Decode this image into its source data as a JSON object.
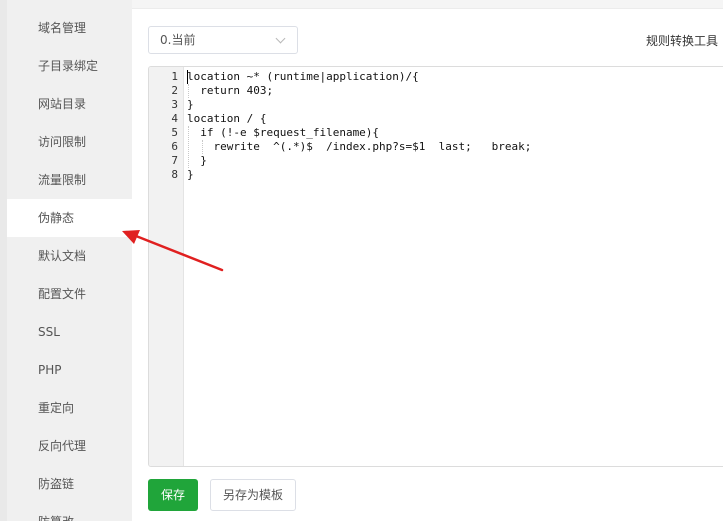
{
  "sidebar": {
    "items": [
      {
        "label": "域名管理"
      },
      {
        "label": "子目录绑定"
      },
      {
        "label": "网站目录"
      },
      {
        "label": "访问限制"
      },
      {
        "label": "流量限制"
      },
      {
        "label": "伪静态"
      },
      {
        "label": "默认文档"
      },
      {
        "label": "配置文件"
      },
      {
        "label": "SSL"
      },
      {
        "label": "PHP"
      },
      {
        "label": "重定向"
      },
      {
        "label": "反向代理"
      },
      {
        "label": "防盗链"
      },
      {
        "label": "防篡改"
      }
    ],
    "active_index": 5
  },
  "toolbar": {
    "version_select_value": "0.当前",
    "rule_tool_label": "规则转换工具"
  },
  "editor": {
    "line_numbers": [
      "1",
      "2",
      "3",
      "4",
      "5",
      "6",
      "7",
      "8"
    ],
    "lines": [
      "location ~* (runtime|application)/{",
      "  return 403;",
      "}",
      "location / {",
      "  if (!-e $request_filename){",
      "    rewrite  ^(.*)$  /index.php?s=$1  last;   break;",
      "  }",
      "}"
    ]
  },
  "actions": {
    "save_label": "保存",
    "save_template_label": "另存为模板"
  },
  "colors": {
    "save_button": "#20a53a",
    "annotation_arrow": "#e02020",
    "sidebar_bg": "#f0f0f0"
  }
}
